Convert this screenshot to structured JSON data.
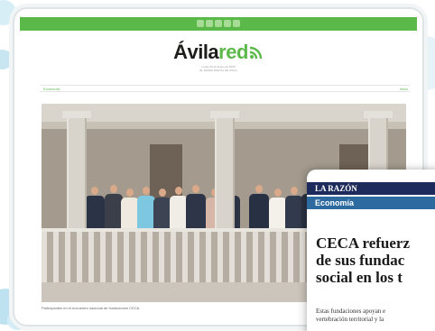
{
  "site": {
    "logo_main": "Ávila",
    "logo_accent": "red",
    "tagline_line1": "Lunes 20 de Enero de 2025",
    "tagline_line2": "EL DIARIO DIGITAL DE ÁVILA"
  },
  "menu": {
    "left_label": "Economía",
    "right_label": "Inicio"
  },
  "photo": {
    "caption": "Participantes en el encuentro nacional de fundaciones CECA"
  },
  "article_card": {
    "brand": "LA RAZÓN",
    "section": "Economía",
    "headline_lines": [
      "CECA refuerz",
      "de sus fundac",
      "social en los t"
    ],
    "body_lines": [
      "Estas fundaciones apoyan e",
      "vertebración territorial y la"
    ]
  },
  "colors": {
    "brand_green": "#5bb949",
    "razon_navy": "#1d2a5c",
    "section_blue": "#2c6aa0"
  },
  "icons": {
    "logo_mark": "wifi-signal-icon",
    "social_row": "social-media-icons"
  }
}
